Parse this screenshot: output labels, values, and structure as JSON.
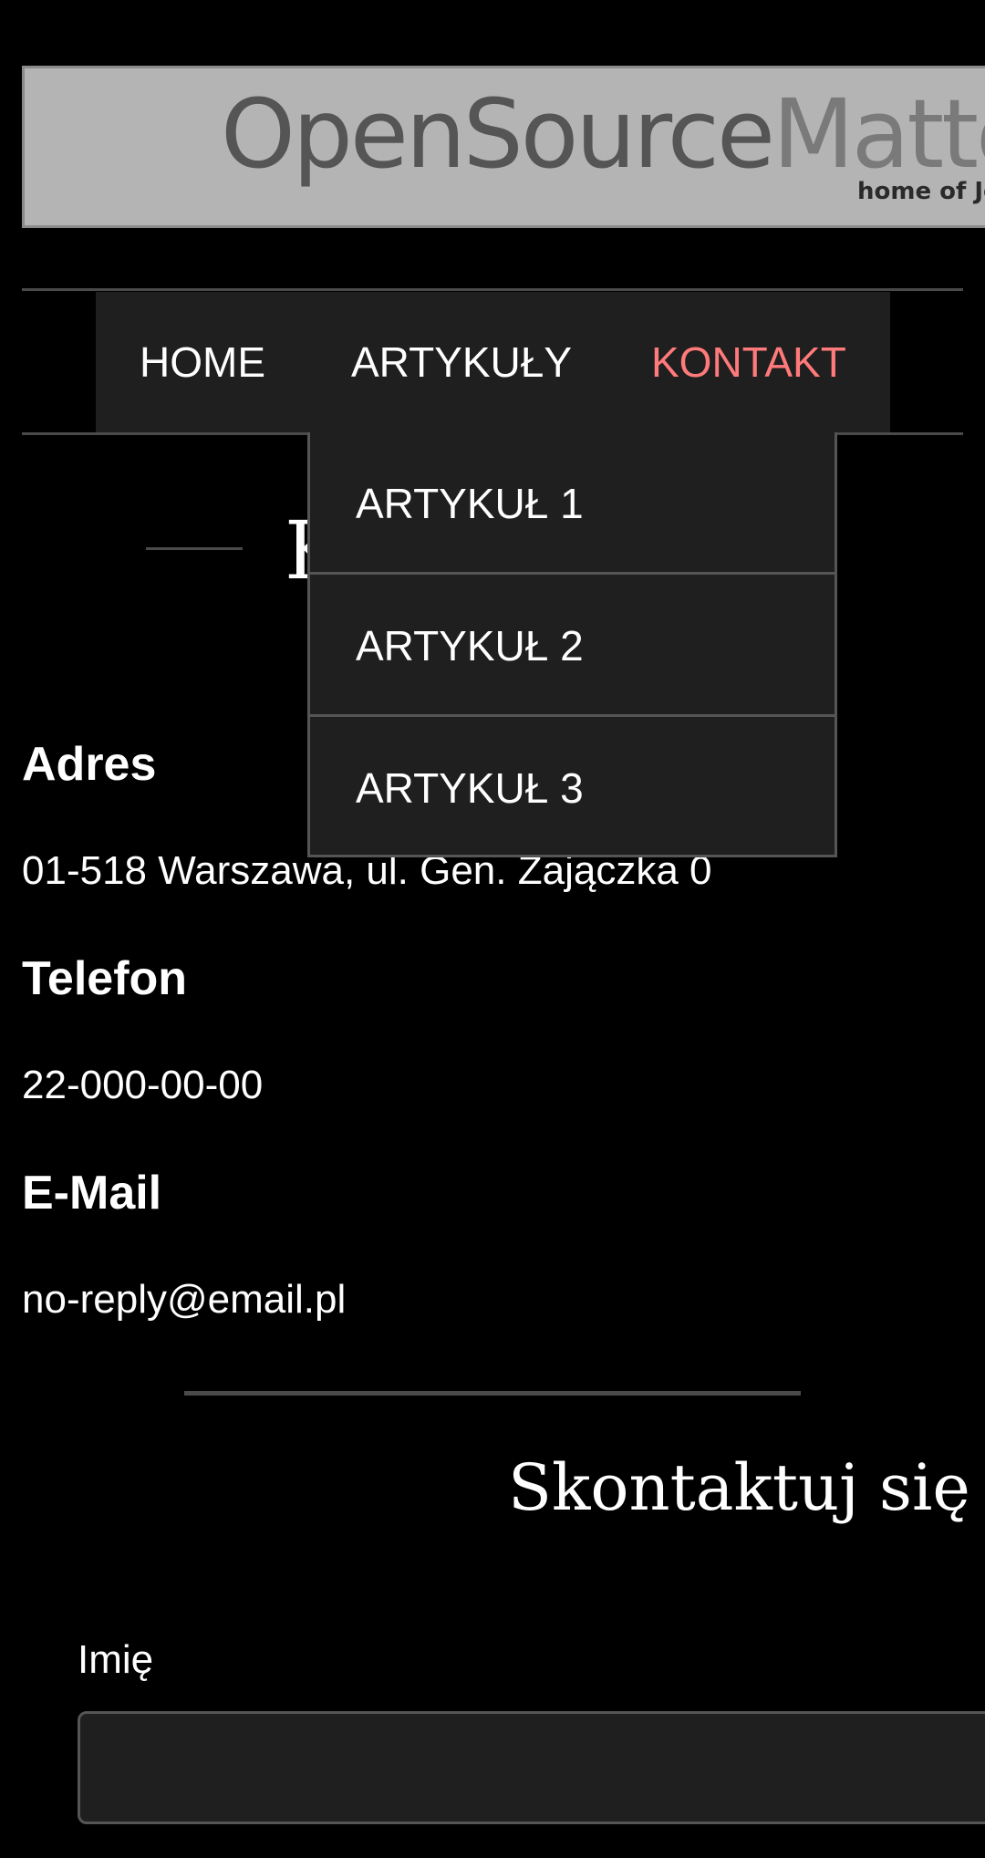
{
  "logo": {
    "text_dark": "OpenSource",
    "text_light": "Matte",
    "tagline": "home of Jo"
  },
  "nav": {
    "items": [
      {
        "label": "HOME"
      },
      {
        "label": "ARTYKUŁY"
      },
      {
        "label": "KONTAKT"
      }
    ],
    "active_color": "#ff7a7a",
    "dropdown": [
      {
        "label": "ARTYKUŁ 1"
      },
      {
        "label": "ARTYKUŁ 2"
      },
      {
        "label": "ARTYKUŁ 3"
      }
    ]
  },
  "page": {
    "heading_visible": "K"
  },
  "contact": {
    "address_label": "Adres",
    "address_value": "01-518 Warszawa, ul. Gen. Zajączka 0",
    "phone_label": "Telefon",
    "phone_value": "22-000-00-00",
    "email_label": "E-Mail",
    "email_value": "no-reply@email.pl"
  },
  "form": {
    "title": "Skontaktuj się z",
    "name_label": "Imię",
    "name_value": ""
  },
  "colors": {
    "background": "#000000",
    "panel": "#1f1f1f",
    "accent": "#ff7a7a"
  }
}
